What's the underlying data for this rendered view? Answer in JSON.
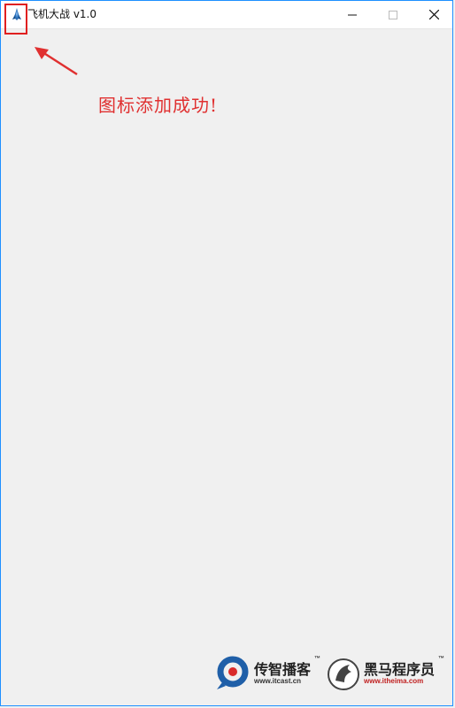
{
  "window": {
    "title": "飞机大战 v1.0",
    "icon": "rocket-icon",
    "controls": {
      "minimize_icon": "minimize-icon",
      "maximize_icon": "maximize-icon",
      "close_icon": "close-icon"
    }
  },
  "annotation": {
    "text": "图标添加成功!",
    "color": "#e03030"
  },
  "watermarks": {
    "itcast": {
      "name": "传智播客",
      "url": "www.itcast.cn",
      "tm": "™"
    },
    "itheima": {
      "name": "黑马程序员",
      "url": "www.itheima.com",
      "tm": "™"
    }
  },
  "colors": {
    "window_border": "#1e90ff",
    "background": "#f0f0f0",
    "highlight": "#e02020"
  }
}
